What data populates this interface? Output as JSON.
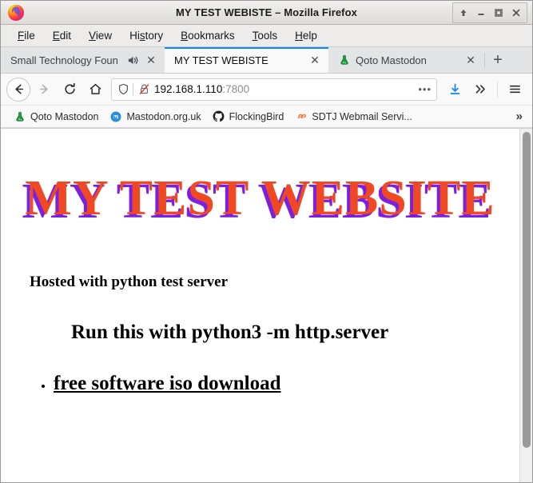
{
  "window": {
    "title": "MY TEST WEBISTE – Mozilla Firefox",
    "logo_icon": "firefox-logo",
    "controls": [
      {
        "name": "shade-button",
        "icon": "up-arrow-icon",
        "glyph": "⇧"
      },
      {
        "name": "minimize-button",
        "icon": "minimize-icon",
        "glyph": "–"
      },
      {
        "name": "maximize-button",
        "icon": "maximize-icon",
        "glyph": "□"
      },
      {
        "name": "close-button",
        "icon": "close-icon",
        "glyph": "✕"
      }
    ]
  },
  "menubar": {
    "items": [
      {
        "pre": "",
        "key": "F",
        "post": "ile",
        "name": "menu-file"
      },
      {
        "pre": "",
        "key": "E",
        "post": "dit",
        "name": "menu-edit"
      },
      {
        "pre": "",
        "key": "V",
        "post": "iew",
        "name": "menu-view"
      },
      {
        "pre": "Hi",
        "key": "s",
        "post": "tory",
        "name": "menu-history"
      },
      {
        "pre": "",
        "key": "B",
        "post": "ookmarks",
        "name": "menu-bookmarks"
      },
      {
        "pre": "",
        "key": "T",
        "post": "ools",
        "name": "menu-tools"
      },
      {
        "pre": "",
        "key": "H",
        "post": "elp",
        "name": "menu-help"
      }
    ]
  },
  "tabs": {
    "items": [
      {
        "label": "Small Technology Foun",
        "favicon": "none",
        "active": false,
        "audio_icon": "speaker-playing-icon",
        "close_glyph": "✕"
      },
      {
        "label": "MY TEST WEBISTE",
        "favicon": "none",
        "active": true,
        "audio_icon": null,
        "close_glyph": "✕"
      },
      {
        "label": "Qoto Mastodon",
        "favicon": "green-flask-icon",
        "active": false,
        "audio_icon": null,
        "close_glyph": "✕"
      }
    ],
    "new_tab_glyph": "+"
  },
  "navbar": {
    "back_glyph": "←",
    "forward_glyph": "→",
    "reload_glyph": "↻",
    "home_glyph": "⌂",
    "url_host": "192.168.1.110",
    "url_port": ":7800",
    "page_actions_glyph": "•••",
    "downloads_icon": "download-arrow-icon",
    "overflow_glyph": "»",
    "menu_glyph": "☰",
    "shield_icon": "shield-icon",
    "lock_icon": "lock-crossed-out-icon",
    "accent_color": "#0a84ff"
  },
  "bookmarks": {
    "items": [
      {
        "label": "Qoto Mastodon",
        "icon": "green-flask-icon"
      },
      {
        "label": "Mastodon.org.uk",
        "icon": "mastodon-icon"
      },
      {
        "label": "FlockingBird",
        "icon": "github-icon"
      },
      {
        "label": "SDTJ Webmail Servi...",
        "icon": "cpanel-icon"
      }
    ],
    "overflow_glyph": "»"
  },
  "page": {
    "heading": "MY TEST WEBSITE",
    "heading_color": "#ef4823",
    "heading_shadow_color": "#7b1fe0",
    "hosted_text": "Hosted with python test server",
    "run_text": "Run this with python3 -m http.server",
    "list_items": [
      {
        "label": "free software iso download"
      }
    ]
  }
}
